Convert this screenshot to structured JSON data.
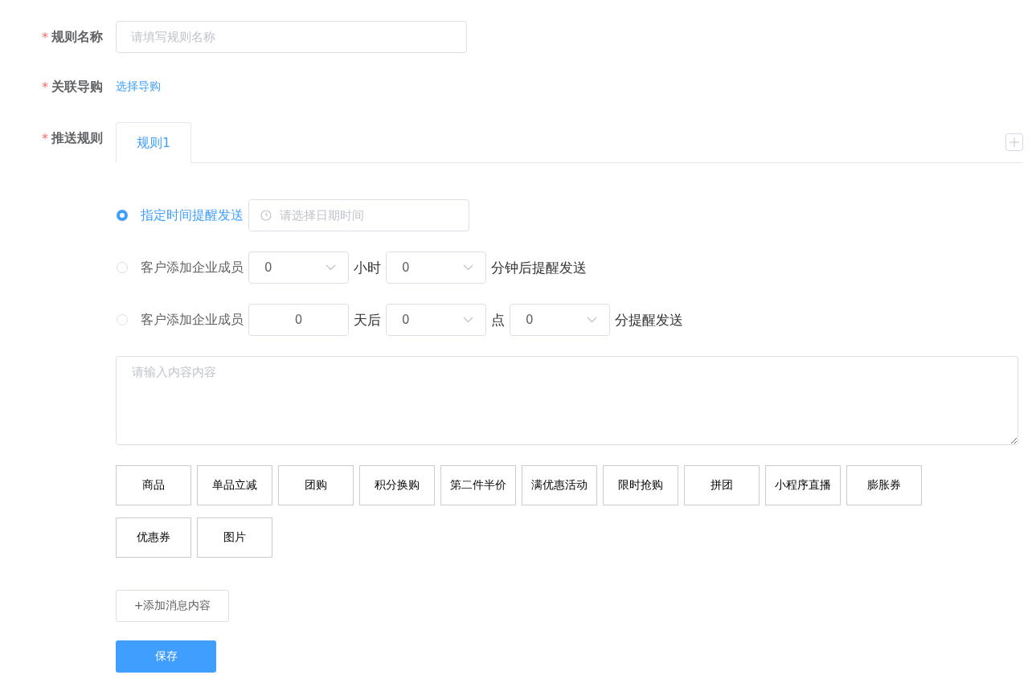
{
  "form": {
    "name_field": {
      "mark": "*",
      "label": "规则名称",
      "placeholder": "请填写规则名称"
    },
    "guide_field": {
      "mark": "*",
      "label": "关联导购",
      "link": "选择导购"
    },
    "rule_field": {
      "mark": "*",
      "label": "推送规则"
    }
  },
  "tabs": [
    {
      "label": "规则1",
      "selected": true
    }
  ],
  "options": [
    {
      "selected": true,
      "label": "指定时间提醒发送",
      "parts": [
        {
          "kind": "datetime",
          "placeholder": "请选择日期时间"
        }
      ]
    },
    {
      "selected": false,
      "label": "客户添加企业成员",
      "parts": [
        {
          "kind": "select",
          "value": "0"
        },
        {
          "kind": "text",
          "text": "小时"
        },
        {
          "kind": "select",
          "value": "0"
        },
        {
          "kind": "text",
          "text": "分钟后提醒发送"
        }
      ]
    },
    {
      "selected": false,
      "label": "客户添加企业成员",
      "parts": [
        {
          "kind": "input",
          "value": "0"
        },
        {
          "kind": "text",
          "text": "天后"
        },
        {
          "kind": "select",
          "value": "0"
        },
        {
          "kind": "text",
          "text": "点"
        },
        {
          "kind": "select",
          "value": "0"
        },
        {
          "kind": "text",
          "text": "分提醒发送"
        }
      ]
    }
  ],
  "content": {
    "placeholder": "请输入内容内容"
  },
  "insert_buttons": [
    "商品",
    "单品立减",
    "团购",
    "积分换购",
    "第二件半价",
    "满优惠活动",
    "限时抢购",
    "拼团",
    "小程序直播",
    "膨胀券",
    "优惠券",
    "图片"
  ],
  "add_message_button": "+添加消息内容",
  "save_button": "保存"
}
